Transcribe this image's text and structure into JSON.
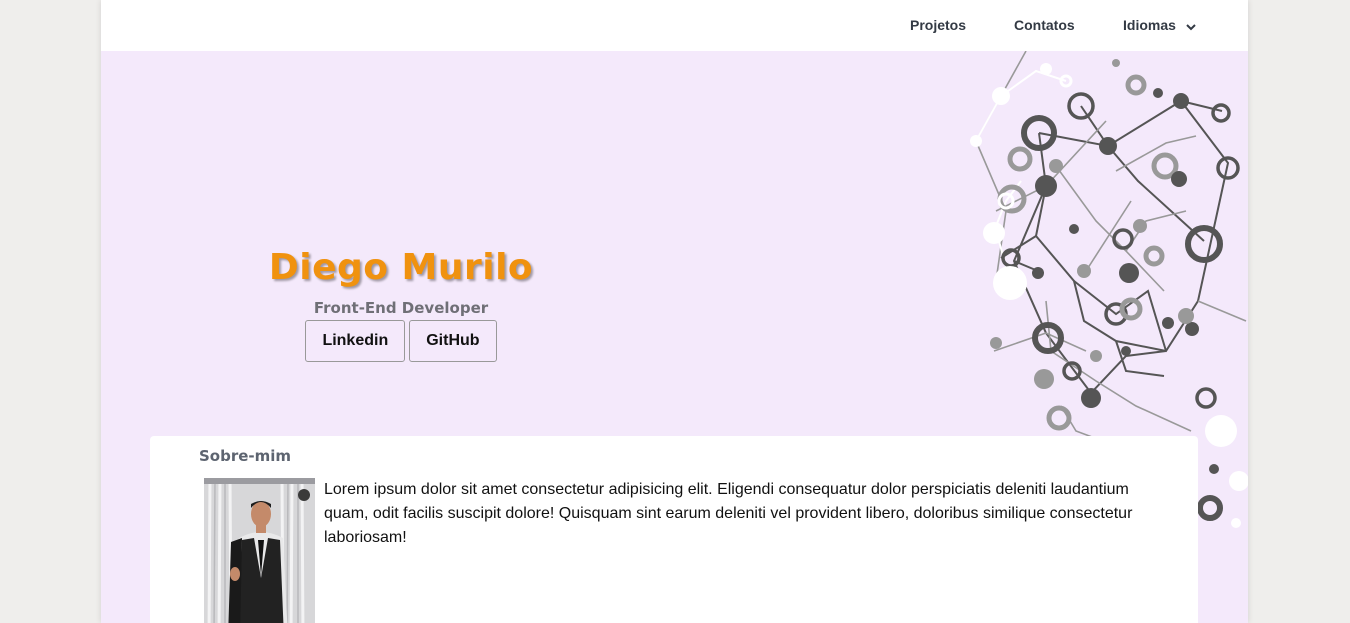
{
  "nav": {
    "projects": "Projetos",
    "contacts": "Contatos",
    "languages": "Idiomas"
  },
  "hero": {
    "name": "Diego Murilo",
    "role": "Front-End Developer",
    "linkedin": "Linkedin",
    "github": "GitHub"
  },
  "about": {
    "title": "Sobre-mim",
    "text": "Lorem ipsum dolor sit amet consectetur adipisicing elit. Eligendi consequatur dolor perspiciatis deleniti laudantium quam, odit facilis suscipit dolore! Quisquam sint earum deleniti vel provident libero, doloribus similique consectetur laboriosam!"
  },
  "colors": {
    "background": "#f4e9fb",
    "accent": "#f0920f",
    "network_dark": "#555555",
    "network_mid": "#999999"
  }
}
